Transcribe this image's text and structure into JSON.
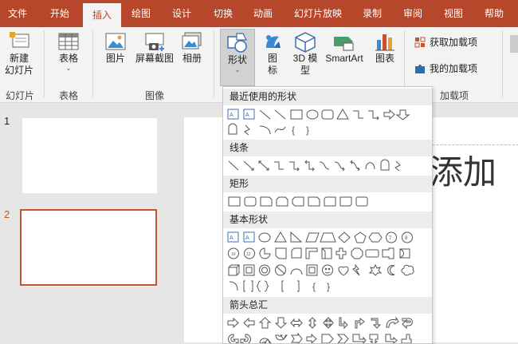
{
  "tabs": [
    "文件",
    "开始",
    "插入",
    "绘图",
    "设计",
    "切换",
    "动画",
    "幻灯片放映",
    "录制",
    "审阅",
    "视图",
    "帮助"
  ],
  "active_tab": "插入",
  "ribbon": {
    "new_slide": {
      "line1": "新建",
      "line2": "幻灯片",
      "caret": "⌄"
    },
    "table": {
      "label": "表格",
      "caret": "⌄"
    },
    "picture": {
      "label": "图片"
    },
    "screenshot": {
      "label": "屏幕截图"
    },
    "album": {
      "label": "相册"
    },
    "shapes": {
      "label": "形状",
      "caret": "⌄"
    },
    "icons": {
      "line1": "图",
      "line2": "标"
    },
    "model3d": {
      "line1": "3D 模",
      "line2": "型"
    },
    "smartart": {
      "label": "SmartArt"
    },
    "chart": {
      "label": "图表"
    },
    "get_addins": {
      "label": "获取加载项"
    },
    "my_addins": {
      "label": "我的加载项"
    },
    "groups": {
      "slides": "幻灯片",
      "tables": "表格",
      "images": "图像",
      "addins": "加载项"
    }
  },
  "slides_panel": {
    "slide1_num": "1",
    "slide2_num": "2"
  },
  "canvas": {
    "title_text": "添加"
  },
  "shapes_menu": {
    "recent": "最近使用的形状",
    "lines": "线条",
    "rectangles": "矩形",
    "basic": "基本形状",
    "arrows": "箭头总汇"
  },
  "colors": {
    "accent": "#b7472a",
    "ribbon_bg": "#f3f3f3",
    "panel_bg": "#e6e6e6",
    "selected_border": "#c4532f"
  }
}
